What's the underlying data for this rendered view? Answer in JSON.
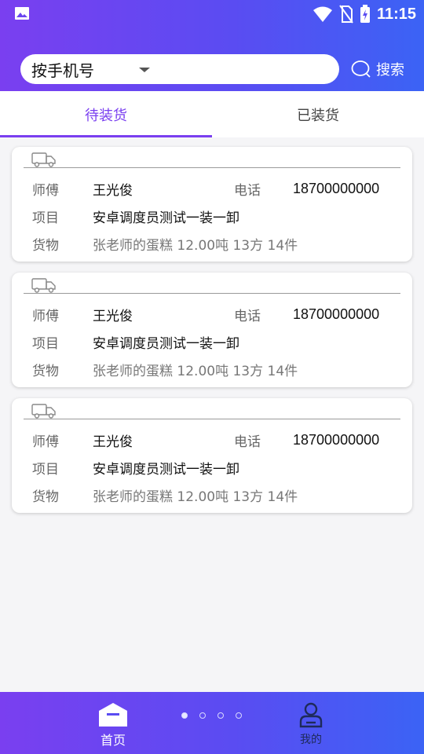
{
  "status_bar": {
    "time": "11:15",
    "icons": [
      "image-icon",
      "wifi-icon",
      "no-sim-icon",
      "battery-charging-icon"
    ]
  },
  "search": {
    "selector_value": "按手机号",
    "button_label": "搜索"
  },
  "tabs": [
    {
      "label": "待装货",
      "active": true
    },
    {
      "label": "已装货",
      "active": false
    }
  ],
  "cards": [
    {
      "driver_label": "师傅",
      "driver": "王光俊",
      "phone_label": "电话",
      "phone": "18700000000",
      "project_label": "项目",
      "project": "安卓调度员测试一装一卸",
      "cargo_label": "货物",
      "cargo": "张老师的蛋糕 12.00吨 13方 14件"
    },
    {
      "driver_label": "师傅",
      "driver": "王光俊",
      "phone_label": "电话",
      "phone": "18700000000",
      "project_label": "项目",
      "project": "安卓调度员测试一装一卸",
      "cargo_label": "货物",
      "cargo": "张老师的蛋糕 12.00吨 13方 14件"
    },
    {
      "driver_label": "师傅",
      "driver": "王光俊",
      "phone_label": "电话",
      "phone": "18700000000",
      "project_label": "项目",
      "project": "安卓调度员测试一装一卸",
      "cargo_label": "货物",
      "cargo": "张老师的蛋糕 12.00吨 13方 14件"
    }
  ],
  "bottom_nav": {
    "home_label": "首页",
    "mine_label": "我的",
    "page_dots": 4,
    "active_dot": 1
  },
  "colors": {
    "accent": "#7a3ff0",
    "gradient_start": "#7a3ff0",
    "gradient_end": "#3b63f5"
  }
}
